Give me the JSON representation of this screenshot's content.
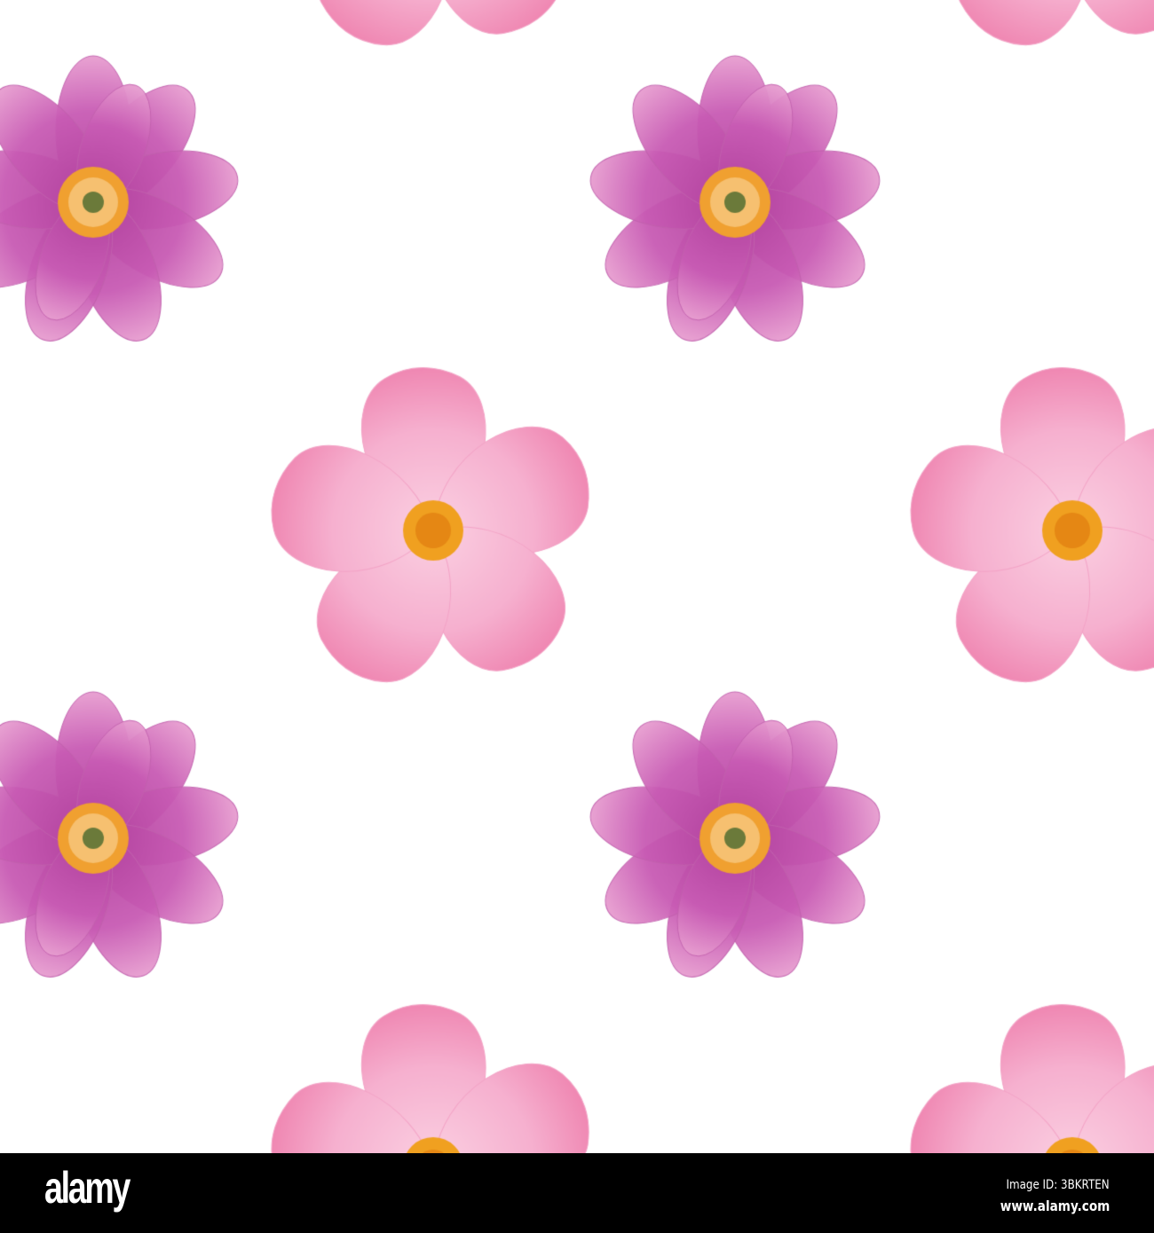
{
  "footer": {
    "logo": "alamy",
    "image_id": "Image ID: 3BKRTEN",
    "url": "www.alamy.com"
  },
  "colors": {
    "dark_petal": "#c85bb4",
    "light_petal": "#f6b0cf",
    "flower_center": "#f0a020",
    "background": "#ffffff"
  }
}
